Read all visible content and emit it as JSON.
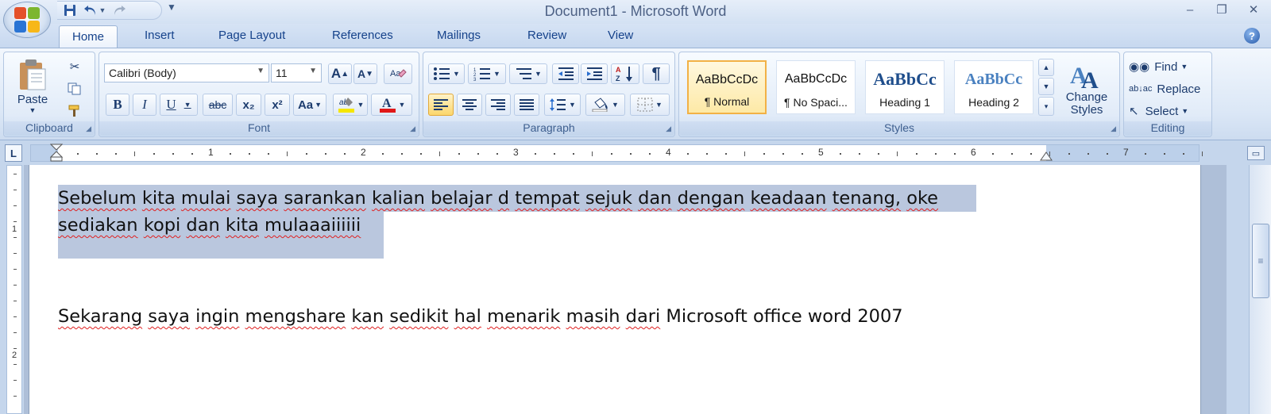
{
  "window": {
    "title": "Document1 - Microsoft Word"
  },
  "quick_access": {
    "save_icon": "save-icon",
    "undo_icon": "undo-icon",
    "redo_icon": "redo-icon",
    "customize_icon": "customize-qat-icon"
  },
  "window_controls": {
    "minimize": "–",
    "restore": "❐",
    "close": "✕"
  },
  "tabs": [
    "Home",
    "Insert",
    "Page Layout",
    "References",
    "Mailings",
    "Review",
    "View"
  ],
  "active_tab": "Home",
  "help_label": "?",
  "ribbon": {
    "clipboard": {
      "label": "Clipboard",
      "paste_label": "Paste"
    },
    "font": {
      "label": "Font",
      "font_name": "Calibri (Body)",
      "font_size": "11",
      "change_case": "Aa",
      "bold": "B",
      "italic": "I",
      "underline": "U",
      "strikethrough": "abc",
      "subscript": "x₂",
      "superscript": "x²",
      "grow_font": "A",
      "shrink_font": "A",
      "highlight_color": "#f5e600",
      "font_color": "#e01818"
    },
    "paragraph": {
      "label": "Paragraph",
      "show_marks": "¶"
    },
    "styles": {
      "label": "Styles",
      "items": [
        {
          "sample": "AaBbCcDc",
          "name": "¶ Normal",
          "selected": true
        },
        {
          "sample": "AaBbCcDc",
          "name": "¶ No Spaci..."
        },
        {
          "sample": "AaBbCc",
          "name": "Heading 1"
        },
        {
          "sample": "AaBbCc",
          "name": "Heading 2"
        }
      ],
      "change_styles_line1": "Change",
      "change_styles_line2": "Styles"
    },
    "editing": {
      "label": "Editing",
      "find": "Find",
      "replace": "Replace",
      "select": "Select"
    }
  },
  "ruler": {
    "tab_selector": "L",
    "numbers": [
      "1",
      "2",
      "3",
      "4",
      "5",
      "6",
      "7"
    ]
  },
  "vertical_ruler": {
    "numbers": [
      "1",
      "2"
    ]
  },
  "document": {
    "selected_paragraph_line1": [
      "Sebelum",
      "kita",
      "mulai",
      "saya",
      "sarankan",
      "kalian",
      "belajar",
      "d",
      "tempat",
      "sejuk",
      "dan",
      "dengan",
      "keadaan",
      "tenang,",
      "oke"
    ],
    "selected_paragraph_line2": [
      "sediakan",
      "kopi",
      "dan",
      "kita",
      "mulaaaiiiiii"
    ],
    "paragraph2": [
      "Sekarang",
      "saya",
      "ingin",
      "mengshare",
      "kan",
      "sedikit",
      "hal",
      "menarik",
      "masih",
      "dari",
      "Microsoft",
      "office",
      "word",
      "2007"
    ]
  }
}
